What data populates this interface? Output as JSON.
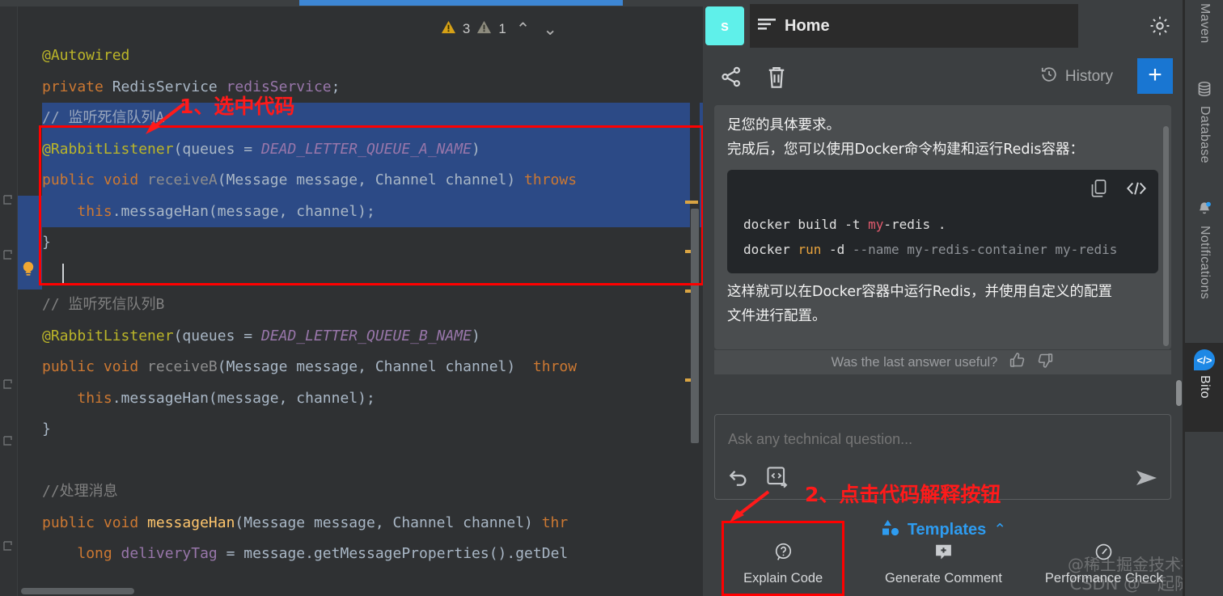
{
  "editor": {
    "inspections": {
      "warning_count": "3",
      "weak_warning_count": "1",
      "prev_label": "⌃",
      "next_label": "⌄"
    },
    "code_lines": [
      {
        "id": "l1",
        "selected": false,
        "segments": [
          {
            "cls": "anno",
            "t": "@Autowired"
          }
        ]
      },
      {
        "id": "l2",
        "selected": false,
        "segments": [
          {
            "cls": "kw",
            "t": "private "
          },
          {
            "cls": "typ",
            "t": "RedisService "
          },
          {
            "cls": "fld",
            "t": "redisService"
          },
          {
            "cls": "pln",
            "t": ";"
          }
        ]
      },
      {
        "id": "l3",
        "selected": true,
        "segments": [
          {
            "cls": "cmtsel",
            "t": "// 监听死信队列A"
          }
        ]
      },
      {
        "id": "l4",
        "selected": true,
        "segments": [
          {
            "cls": "anno",
            "t": "@RabbitListener"
          },
          {
            "cls": "pln",
            "t": "(queues = "
          },
          {
            "cls": "cnst",
            "t": "DEAD_LETTER_QUEUE_A_NAME"
          },
          {
            "cls": "pln",
            "t": ")"
          }
        ]
      },
      {
        "id": "l5",
        "selected": true,
        "segments": [
          {
            "cls": "kw",
            "t": "public void "
          },
          {
            "cls": "mth",
            "t": "receiveA"
          },
          {
            "cls": "pln",
            "t": "(Message message, Channel channel) "
          },
          {
            "cls": "kw",
            "t": "throws"
          }
        ]
      },
      {
        "id": "l6",
        "selected": true,
        "segments": [
          {
            "cls": "pln",
            "t": "    "
          },
          {
            "cls": "kw",
            "t": "this"
          },
          {
            "cls": "pln",
            "t": ".messageHan(message, channel);"
          }
        ]
      },
      {
        "id": "l7",
        "selected": false,
        "segments": [
          {
            "cls": "pln",
            "t": "}"
          }
        ]
      },
      {
        "id": "l8",
        "selected": false,
        "segments": [
          {
            "cls": "pln",
            "t": ""
          }
        ]
      },
      {
        "id": "l9",
        "selected": false,
        "segments": [
          {
            "cls": "cmt",
            "t": "// 监听死信队列B"
          }
        ]
      },
      {
        "id": "l10",
        "selected": false,
        "segments": [
          {
            "cls": "anno",
            "t": "@RabbitListener"
          },
          {
            "cls": "pln",
            "t": "(queues = "
          },
          {
            "cls": "cnst",
            "t": "DEAD_LETTER_QUEUE_B_NAME"
          },
          {
            "cls": "pln",
            "t": ")"
          }
        ]
      },
      {
        "id": "l11",
        "selected": false,
        "segments": [
          {
            "cls": "kw",
            "t": "public void "
          },
          {
            "cls": "mth",
            "t": "receiveB"
          },
          {
            "cls": "pln",
            "t": "(Message message, Channel channel)  "
          },
          {
            "cls": "kw",
            "t": "throw"
          }
        ]
      },
      {
        "id": "l12",
        "selected": false,
        "segments": [
          {
            "cls": "pln",
            "t": "    "
          },
          {
            "cls": "kw",
            "t": "this"
          },
          {
            "cls": "pln",
            "t": ".messageHan(message, channel);"
          }
        ]
      },
      {
        "id": "l13",
        "selected": false,
        "segments": [
          {
            "cls": "pln",
            "t": "}"
          }
        ]
      },
      {
        "id": "l14",
        "selected": false,
        "segments": [
          {
            "cls": "pln",
            "t": ""
          }
        ]
      },
      {
        "id": "l15",
        "selected": false,
        "segments": [
          {
            "cls": "cmt",
            "t": "//处理消息"
          }
        ]
      },
      {
        "id": "l16",
        "selected": false,
        "segments": [
          {
            "cls": "kw",
            "t": "public void "
          },
          {
            "cls": "mthB",
            "t": "messageHan"
          },
          {
            "cls": "pln",
            "t": "(Message message, Channel channel) "
          },
          {
            "cls": "kw",
            "t": "thr"
          }
        ]
      },
      {
        "id": "l17",
        "selected": false,
        "segments": [
          {
            "cls": "pln",
            "t": "    "
          },
          {
            "cls": "kw",
            "t": "long "
          },
          {
            "cls": "fld",
            "t": "deliveryTag"
          },
          {
            "cls": "pln",
            "t": " = message.getMessageProperties().getDel"
          }
        ]
      }
    ]
  },
  "annotations": {
    "step1": "1、选中代码",
    "step2": "2、点击代码解释按钮"
  },
  "bito": {
    "logo_letter": "s",
    "tab_label": "Home",
    "toolbar": {
      "history_label": "History",
      "plus_label": "+"
    },
    "conversation": {
      "paragraph_1": "足您的具体要求。",
      "paragraph_2": "完成后，您可以使用Docker命令构建和运行Redis容器：",
      "code_block": {
        "line1": [
          {
            "cls": "sh-kw",
            "t": "docker build -t "
          },
          {
            "cls": "sh-str",
            "t": "my"
          },
          {
            "cls": "sh-kw",
            "t": "-redis ."
          }
        ],
        "line2": [
          {
            "cls": "sh-kw",
            "t": "docker "
          },
          {
            "cls": "sh-run",
            "t": "run"
          },
          {
            "cls": "sh-kw",
            "t": " -d "
          },
          {
            "cls": "sh-flag",
            "t": "--name my-redis-container my-redis"
          }
        ]
      },
      "paragraph_3": "这样就可以在Docker容器中运行Redis，并使用自定义的配置",
      "paragraph_4": "文件进行配置。"
    },
    "feedback_label": "Was the last answer useful?",
    "input_placeholder": "Ask any technical question...",
    "templates_label": "Templates",
    "templates_chevron": "⌃",
    "actions": [
      {
        "label": "Explain Code",
        "icon": "question-circle-icon"
      },
      {
        "label": "Generate Comment",
        "icon": "comment-plus-icon"
      },
      {
        "label": "Performance Check",
        "icon": "gauge-icon"
      }
    ]
  },
  "right_sidebar": {
    "items": [
      {
        "label": "Maven",
        "icon": "maven-icon",
        "active": false
      },
      {
        "label": "Database",
        "icon": "database-icon",
        "active": false
      },
      {
        "label": "Notifications",
        "icon": "bell-icon",
        "active": false
      },
      {
        "label": "Bito",
        "icon": "bito-icon",
        "active": true
      }
    ]
  },
  "watermarks": {
    "line1": "@稀土掘金技术社区",
    "line2": "CSDN @一起随缘"
  },
  "colors": {
    "selection": "#2c4a86",
    "annotation_red": "#ff1a1a",
    "accent_blue": "#1976d2",
    "templates_blue": "#2e9cf0",
    "logo_cyan": "#5ff0ea",
    "warning_yellow": "#d9a443"
  }
}
